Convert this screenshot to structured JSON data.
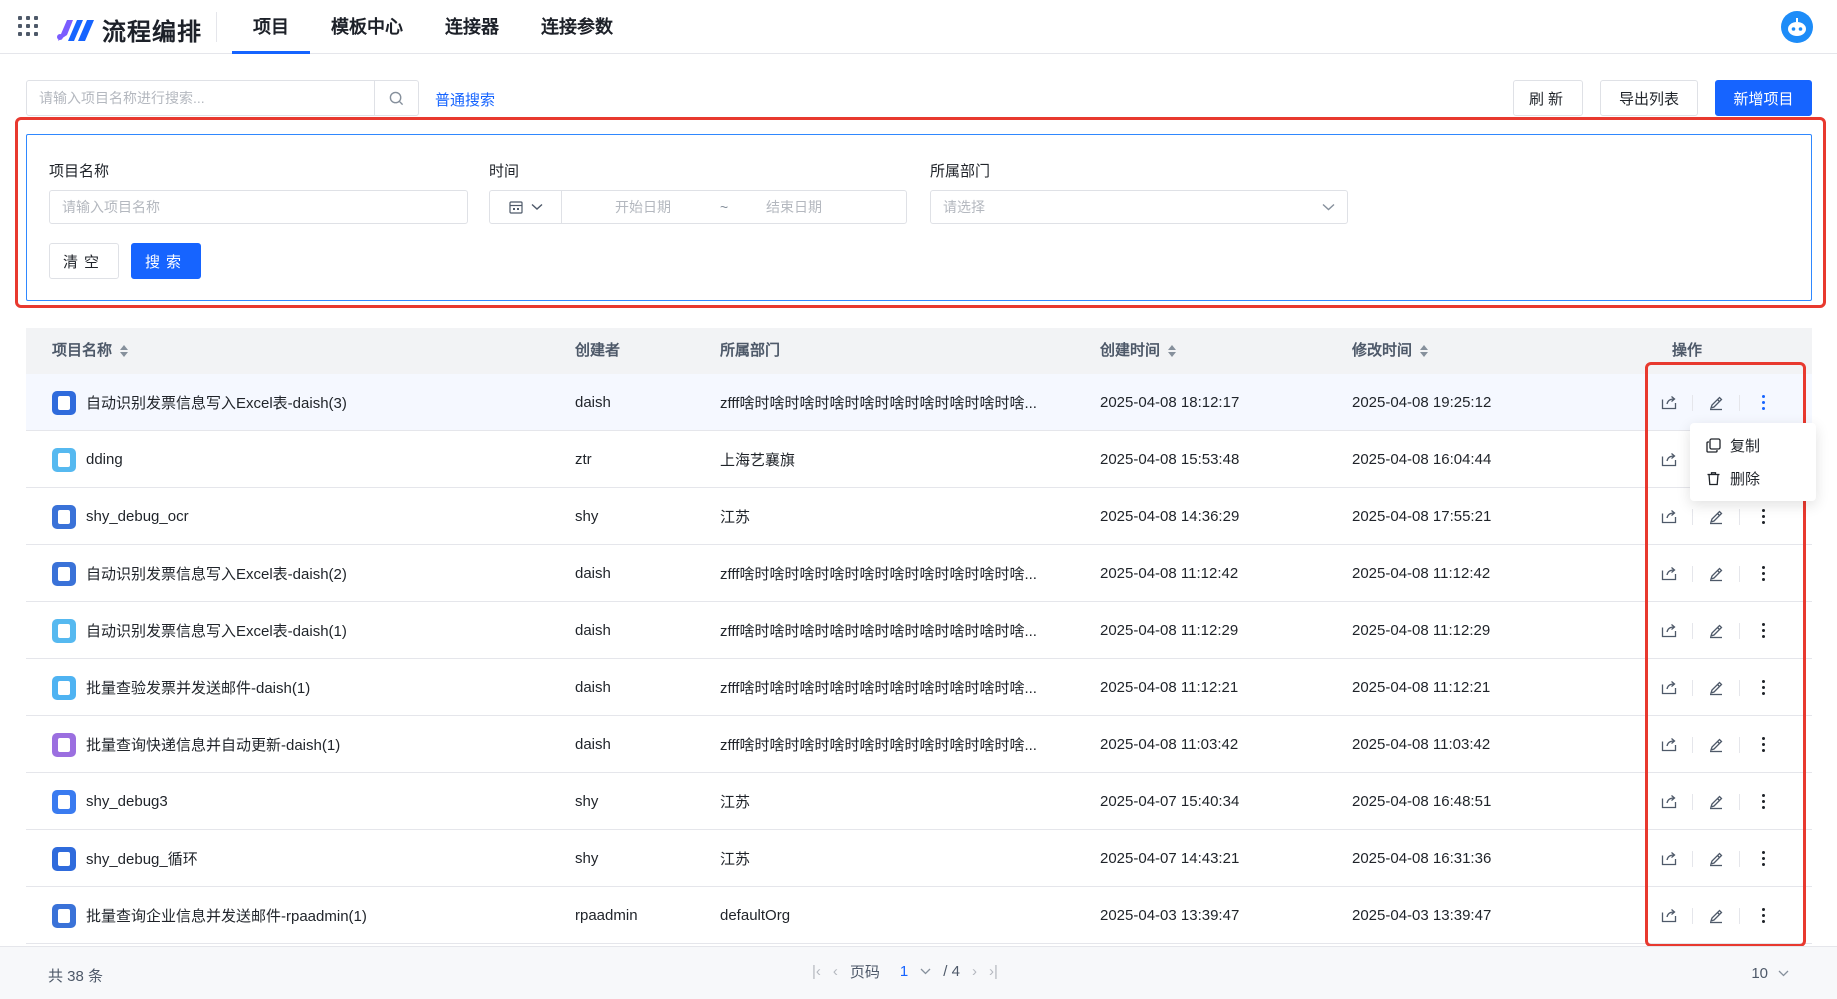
{
  "header": {
    "logo_text": "流程编排",
    "nav": [
      {
        "label": "项目",
        "active": true
      },
      {
        "label": "模板中心",
        "active": false
      },
      {
        "label": "连接器",
        "active": false
      },
      {
        "label": "连接参数",
        "active": false
      }
    ]
  },
  "search": {
    "placeholder": "请输入项目名称进行搜索...",
    "mode_link": "普通搜索"
  },
  "toolbar": {
    "refresh_label": "刷新",
    "export_label": "导出列表",
    "add_label": "新增项目"
  },
  "filter": {
    "name_label": "项目名称",
    "name_placeholder": "请输入项目名称",
    "time_label": "时间",
    "start_placeholder": "开始日期",
    "range_sep": "~",
    "end_placeholder": "结束日期",
    "dept_label": "所属部门",
    "dept_placeholder": "请选择",
    "clear_label": "清空",
    "search_label": "搜索"
  },
  "table": {
    "columns": {
      "name": "项目名称",
      "creator": "创建者",
      "dept": "所属部门",
      "created": "创建时间",
      "modified": "修改时间",
      "ops": "操作"
    },
    "rows": [
      {
        "name": "自动识别发票信息写入Excel表-daish(3)",
        "creator": "daish",
        "dept": "zfff啥时啥时啥时啥时啥时啥时啥时啥时啥时啥...",
        "created": "2025-04-08 18:12:17",
        "modified": "2025-04-08 19:25:12",
        "icon_color": "#2f6bdc"
      },
      {
        "name": "dding",
        "creator": "ztr",
        "dept": "上海艺襄旗",
        "created": "2025-04-08 15:53:48",
        "modified": "2025-04-08 16:04:44",
        "icon_color": "#56b9f0"
      },
      {
        "name": "shy_debug_ocr",
        "creator": "shy",
        "dept": "江苏",
        "created": "2025-04-08 14:36:29",
        "modified": "2025-04-08 17:55:21",
        "icon_color": "#3a72d8"
      },
      {
        "name": "自动识别发票信息写入Excel表-daish(2)",
        "creator": "daish",
        "dept": "zfff啥时啥时啥时啥时啥时啥时啥时啥时啥时啥...",
        "created": "2025-04-08 11:12:42",
        "modified": "2025-04-08 11:12:42",
        "icon_color": "#3a72d8"
      },
      {
        "name": "自动识别发票信息写入Excel表-daish(1)",
        "creator": "daish",
        "dept": "zfff啥时啥时啥时啥时啥时啥时啥时啥时啥时啥...",
        "created": "2025-04-08 11:12:29",
        "modified": "2025-04-08 11:12:29",
        "icon_color": "#56b9f0"
      },
      {
        "name": "批量查验发票并发送邮件-daish(1)",
        "creator": "daish",
        "dept": "zfff啥时啥时啥时啥时啥时啥时啥时啥时啥时啥...",
        "created": "2025-04-08 11:12:21",
        "modified": "2025-04-08 11:12:21",
        "icon_color": "#4fb3f2"
      },
      {
        "name": "批量查询快递信息并自动更新-daish(1)",
        "creator": "daish",
        "dept": "zfff啥时啥时啥时啥时啥时啥时啥时啥时啥时啥...",
        "created": "2025-04-08 11:03:42",
        "modified": "2025-04-08 11:03:42",
        "icon_color": "#9b6fe0"
      },
      {
        "name": "shy_debug3",
        "creator": "shy",
        "dept": "江苏",
        "created": "2025-04-07 15:40:34",
        "modified": "2025-04-08 16:48:51",
        "icon_color": "#3a7bf0"
      },
      {
        "name": "shy_debug_循环",
        "creator": "shy",
        "dept": "江苏",
        "created": "2025-04-07 14:43:21",
        "modified": "2025-04-08 16:31:36",
        "icon_color": "#2f6bdc"
      },
      {
        "name": "批量查询企业信息并发送邮件-rpaadmin(1)",
        "creator": "rpaadmin",
        "dept": "defaultOrg",
        "created": "2025-04-03 13:39:47",
        "modified": "2025-04-03 13:39:47",
        "icon_color": "#3a72d8"
      }
    ]
  },
  "dropdown": {
    "copy_label": "复制",
    "delete_label": "删除"
  },
  "footer": {
    "total": "共 38 条",
    "page_label": "页码",
    "current_page": "1",
    "total_pages": "/ 4",
    "page_size": "10"
  },
  "colors": {
    "primary": "#1664ff",
    "highlight_border": "#e8392f"
  }
}
